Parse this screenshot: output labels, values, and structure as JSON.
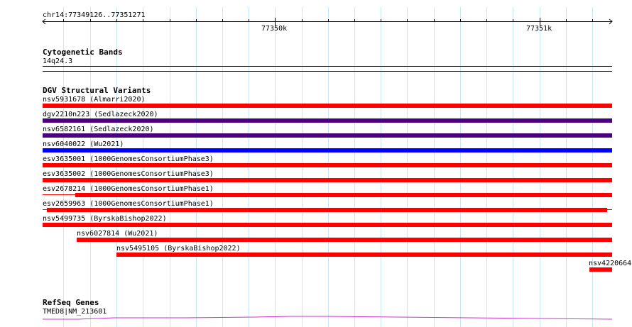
{
  "ruler": {
    "location": "chr14:77349126..77351271",
    "tick_labels": [
      "77350k",
      "77351k"
    ]
  },
  "cytoband": {
    "title": "Cytogenetic Bands",
    "band": "14q24.3"
  },
  "dgv": {
    "title": "DGV Structural Variants",
    "variants": [
      {
        "label": "nsv5931678 (Almarri2020)",
        "color": "#ff0000"
      },
      {
        "label": "dgv2210n223 (Sedlazeck2020)",
        "color": "#4b0082"
      },
      {
        "label": "nsv6582161 (Sedlazeck2020)",
        "color": "#4b0082"
      },
      {
        "label": "nsv6040022 (Wu2021)",
        "color": "#0000ff"
      },
      {
        "label": "esv3635001 (1000GenomesConsortiumPhase3)",
        "color": "#ff0000"
      },
      {
        "label": "esv3635002 (1000GenomesConsortiumPhase3)",
        "color": "#ff0000"
      },
      {
        "label": "esv2678214 (1000GenomesConsortiumPhase1)",
        "color": "#ff0000"
      },
      {
        "label": "esv2659963 (1000GenomesConsortiumPhase1)",
        "color": "#ff0000"
      },
      {
        "label": "nsv5499735 (ByrskaBishop2022)",
        "color": "#ff0000"
      },
      {
        "label": "nsv6027814 (Wu2021)",
        "color": "#ff0000"
      },
      {
        "label": "nsv5495105 (ByrskaBishop2022)",
        "color": "#ff0000"
      },
      {
        "label": "nsv4220664",
        "color": "#ff0000"
      }
    ]
  },
  "refseq": {
    "title": "RefSeq Genes",
    "gene": "TMED8|NM_213601",
    "color": "#cc33cc"
  }
}
